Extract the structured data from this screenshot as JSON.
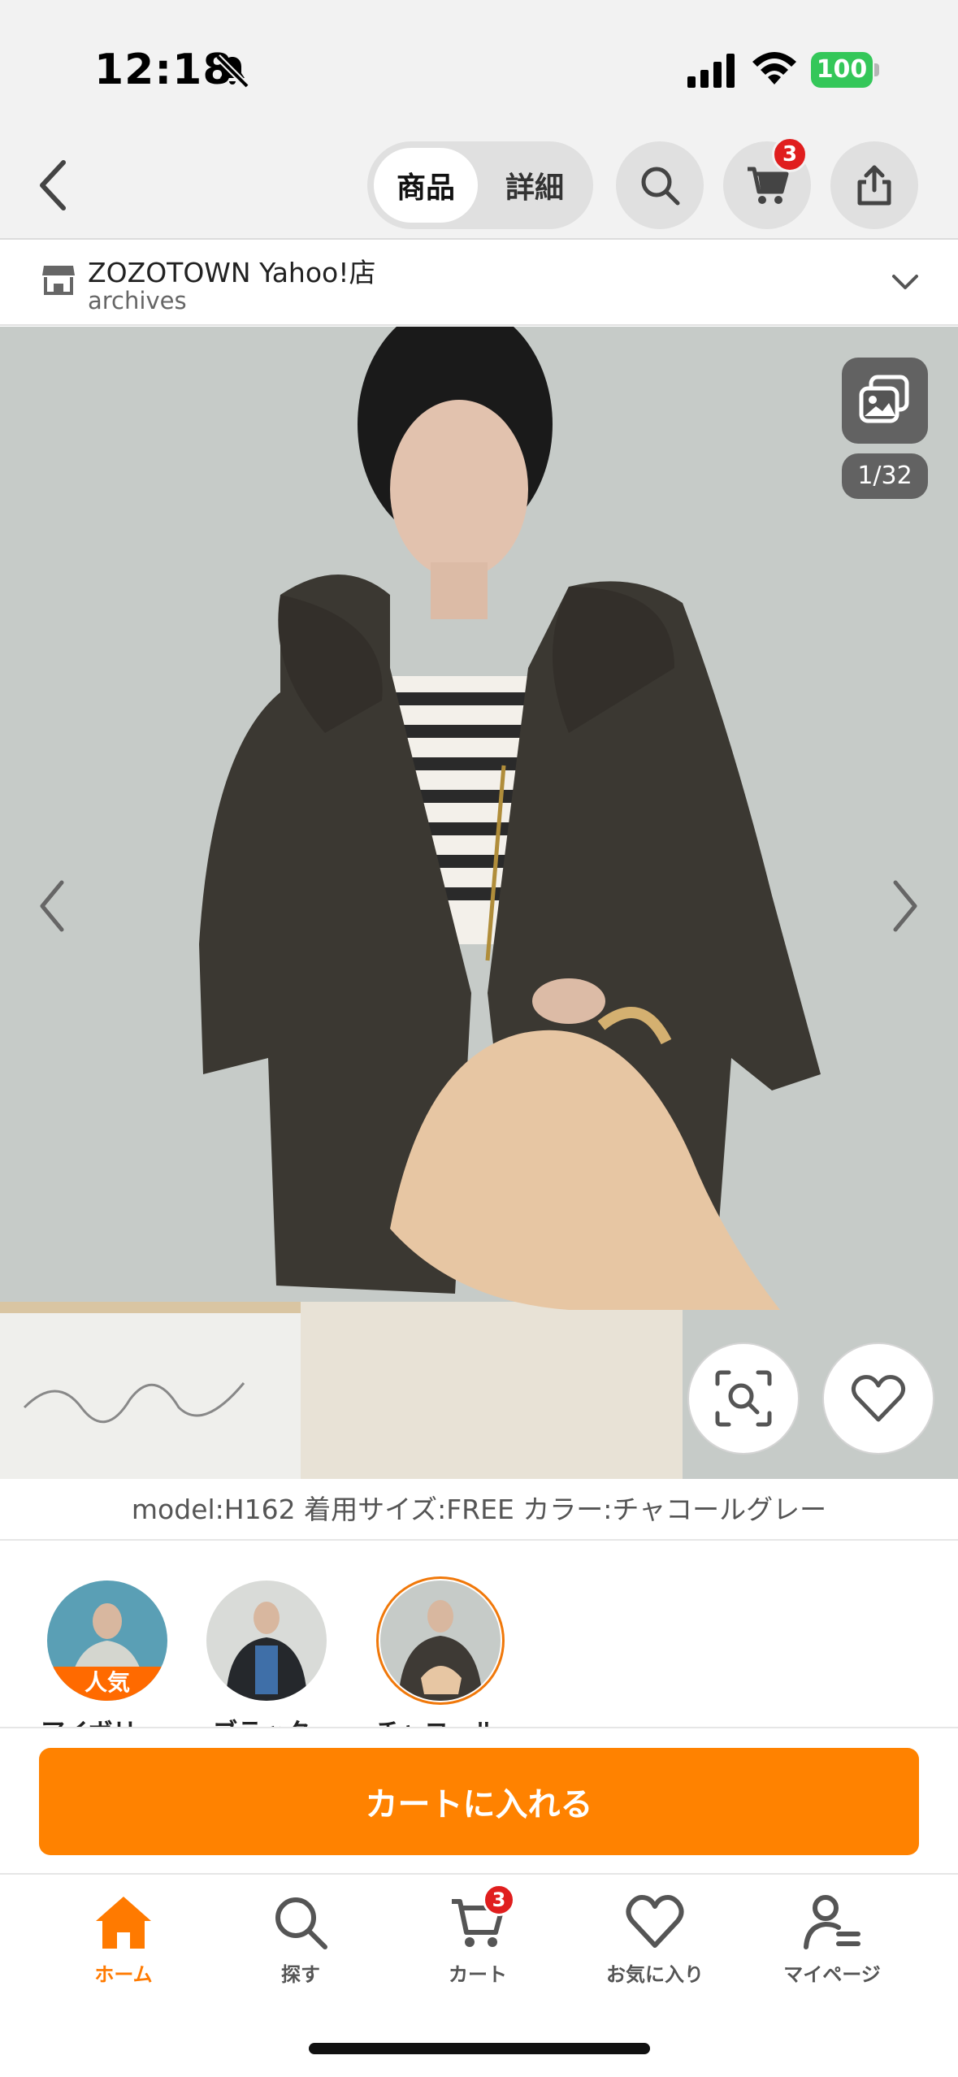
{
  "status_bar": {
    "time": "12:18",
    "battery": "100"
  },
  "nav": {
    "tabs": [
      "商品",
      "詳細"
    ],
    "active_tab": "商品",
    "cart_count": "3",
    "icons": [
      "back-chevron-icon",
      "search-icon",
      "cart-icon",
      "share-icon"
    ]
  },
  "store": {
    "name": "ZOZOTOWN Yahoo!店",
    "sub": "archives"
  },
  "gallery": {
    "counter": "1/32"
  },
  "caption": "model:H162 着用サイズ:FREE カラー:チャコールグレー",
  "variants": [
    {
      "label": "アイボリー",
      "badge": "人気",
      "color": "#c9cdc6"
    },
    {
      "label": "ブラック",
      "badge": "",
      "color": "#25282c"
    },
    {
      "label": "チャコール",
      "badge": "",
      "color": "#3e3a35",
      "selected": true
    }
  ],
  "cta": {
    "label": "カートに入れる"
  },
  "tabbar": {
    "items": [
      {
        "label": "ホーム",
        "icon": "home-icon",
        "active": true
      },
      {
        "label": "探す",
        "icon": "search-icon"
      },
      {
        "label": "カート",
        "icon": "cart-icon",
        "badge": "3"
      },
      {
        "label": "お気に入り",
        "icon": "heart-icon"
      },
      {
        "label": "マイページ",
        "icon": "profile-icon"
      }
    ]
  },
  "colors": {
    "accent": "#ff8200",
    "badge": "#e01e1e"
  }
}
